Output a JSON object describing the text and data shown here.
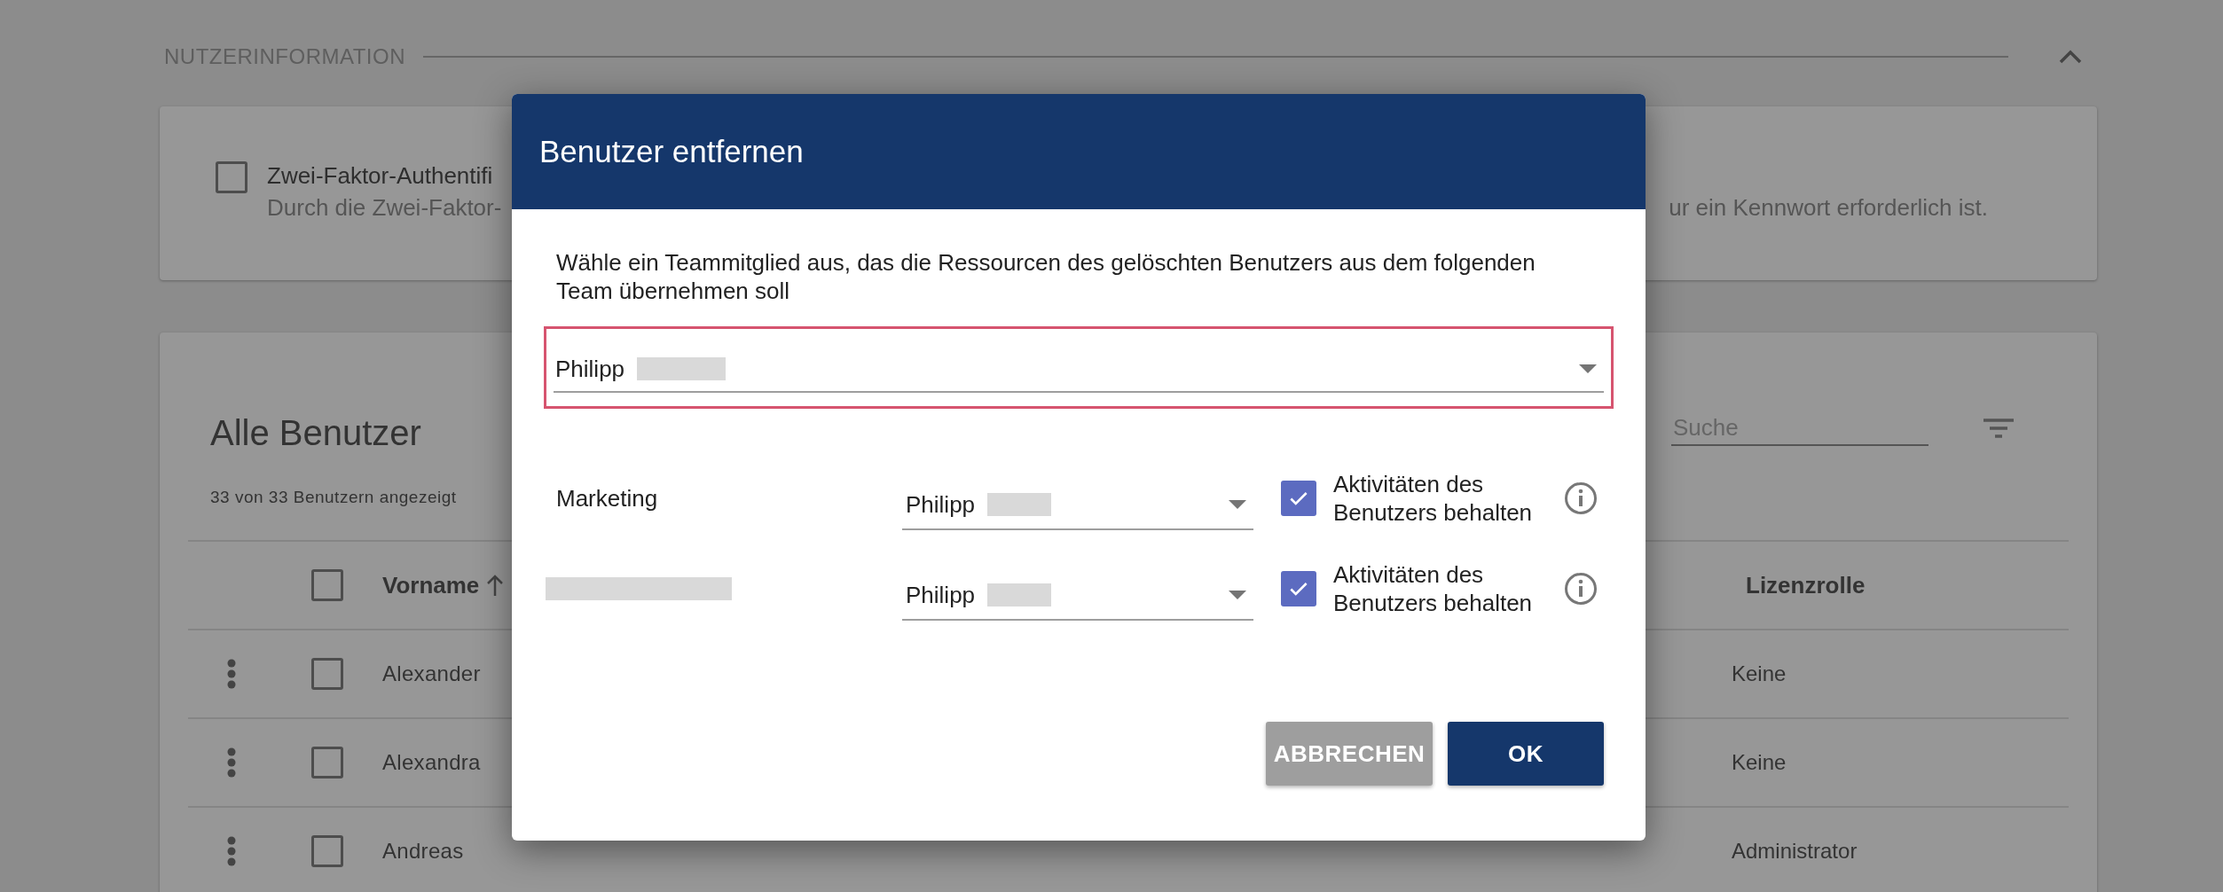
{
  "section": {
    "title": "NUTZERINFORMATION",
    "expanded": true
  },
  "two_factor": {
    "checked": false,
    "label": "Zwei-Faktor-Authentifi",
    "description_start": "Durch die Zwei-Faktor-",
    "description_end": "ur ein Kennwort erforderlich ist."
  },
  "users": {
    "title": "Alle Benutzer",
    "count": "33 von 33 Benutzern angezeigt",
    "search": {
      "placeholder": "Suche"
    },
    "all_checked": false,
    "columns": [
      {
        "label": "Vorname",
        "sorted": true
      },
      {
        "label": "Lizenzrolle",
        "sorted": false
      }
    ],
    "rows": [
      {
        "first_name": "Alexander",
        "license_role": "Keine",
        "checked": false
      },
      {
        "first_name": "Alexandra",
        "license_role": "Keine",
        "checked": false
      },
      {
        "first_name": "Andreas",
        "license_role": "Administrator",
        "checked": false
      }
    ]
  },
  "dialog": {
    "title": "Benutzer entfernen",
    "message": "Wähle ein Teammitglied aus, das die Ressourcen des gelöschten Benutzers aus dem folgenden Team übernehmen soll",
    "assignee_select": {
      "value": "Philipp",
      "highlighted": true
    },
    "teams": [
      {
        "kind": "named",
        "name": "Marketing",
        "assignee": "Philipp",
        "keep_activities": true,
        "keep_label": "Aktivitäten des Benutzers behalten"
      },
      {
        "kind": "redacted",
        "assignee": "Philipp",
        "keep_activities": true,
        "keep_label": "Aktivitäten des Benutzers behalten"
      }
    ],
    "buttons": [
      {
        "label": "ABBRECHEN",
        "kind": "secondary"
      },
      {
        "label": "OK",
        "kind": "primary"
      }
    ]
  }
}
